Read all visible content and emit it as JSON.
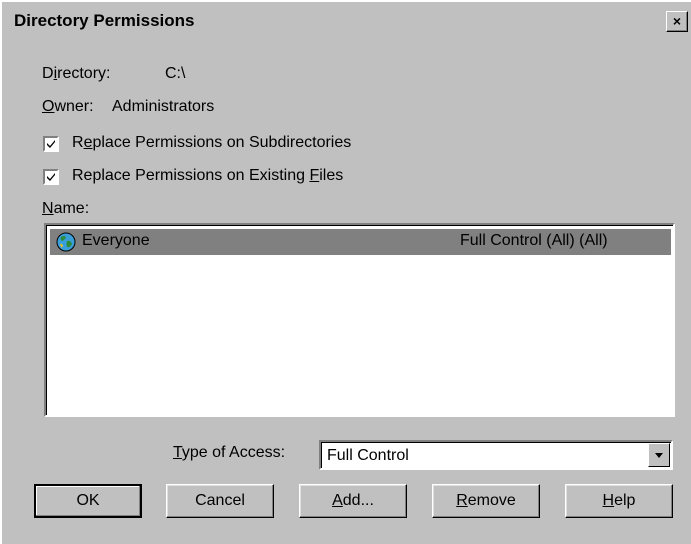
{
  "window": {
    "title": "Directory Permissions",
    "close_label": "×"
  },
  "directory": {
    "label": "Directory:",
    "label_mnemonic": "i",
    "value": "C:\\"
  },
  "owner": {
    "label": "Owner:",
    "value": "Administrators"
  },
  "checkboxes": [
    {
      "label": "Replace Permissions on Subdirectories",
      "checked": true
    },
    {
      "label": "Replace Permissions on Existing Files",
      "checked": true
    }
  ],
  "names_label": "Name:",
  "permissions_list": [
    {
      "name": "Everyone",
      "access": "Full Control (All) (All)",
      "icon": "globe-icon",
      "selected": true
    }
  ],
  "type_of_access": {
    "label": "Type of Access:",
    "value": "Full Control"
  },
  "buttons": {
    "ok": "OK",
    "cancel": "Cancel",
    "add": "Add...",
    "remove": "Remove",
    "help": "Help"
  },
  "colors": {
    "face": "#c0c0c0",
    "selection": "#808080"
  }
}
